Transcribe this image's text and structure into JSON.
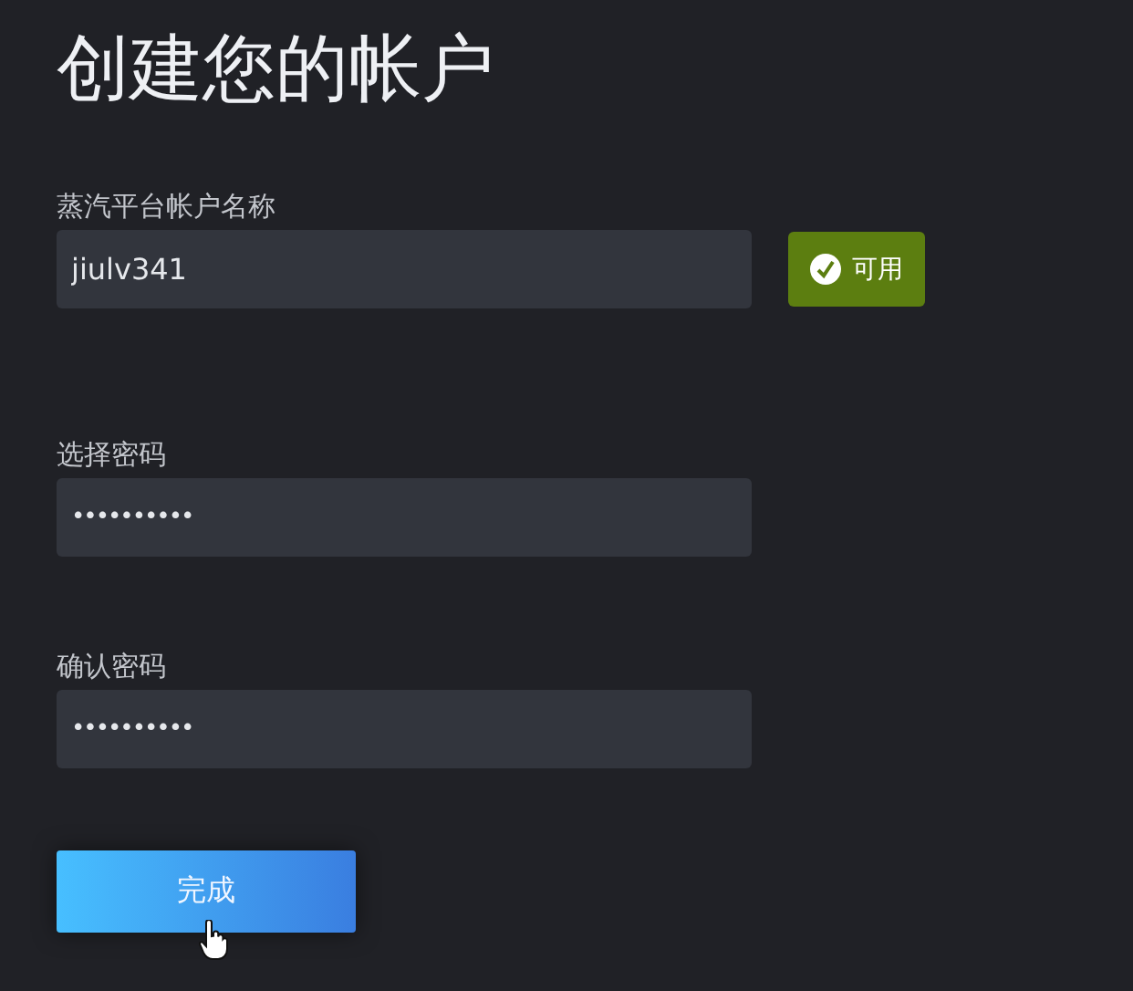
{
  "title": "创建您的帐户",
  "fields": [
    {
      "kind": "username",
      "label": "蒸汽平台帐户名称",
      "value": "jiulv341",
      "badge": {
        "text": "可用",
        "available": true
      }
    },
    {
      "kind": "password",
      "label": "选择密码",
      "value": "••••••••••"
    },
    {
      "kind": "password",
      "label": "确认密码",
      "value": "••••••••••"
    }
  ],
  "submit": {
    "label": "完成"
  }
}
